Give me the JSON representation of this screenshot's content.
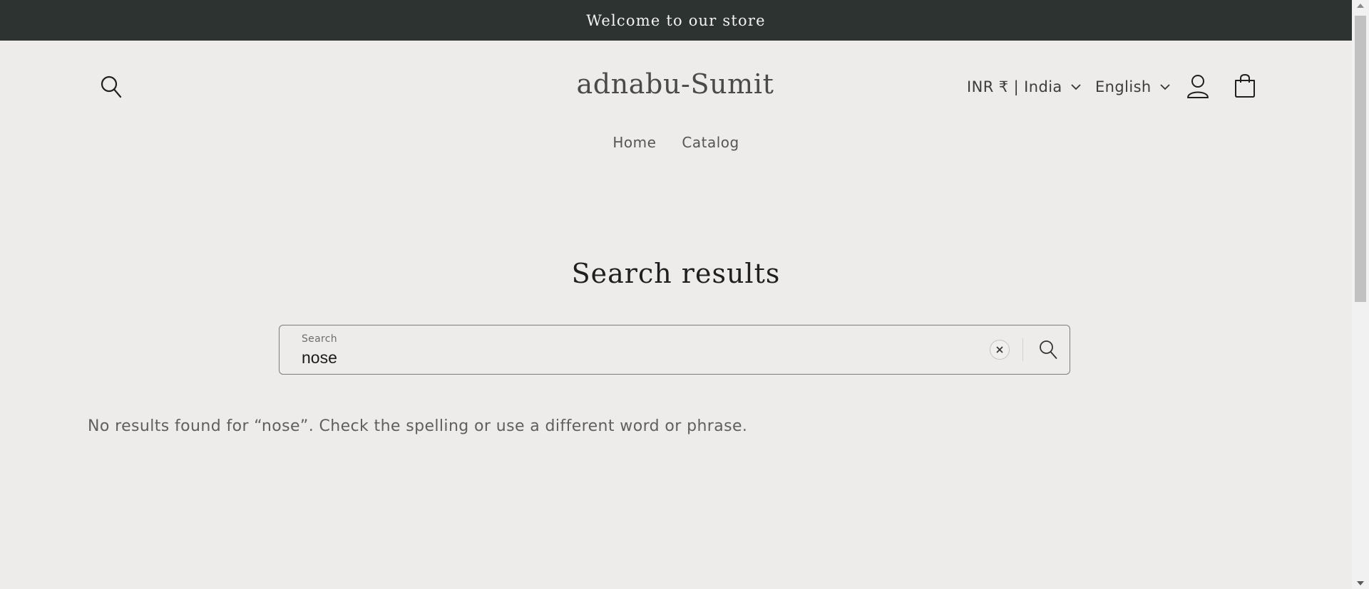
{
  "announcement": {
    "text": "Welcome to our store"
  },
  "header": {
    "logo": "adnabu-Sumit",
    "country_selector": "INR ₹ | India",
    "language_selector": "English",
    "icons": {
      "search": "search-icon",
      "account": "account-icon",
      "cart": "cart-icon",
      "chevron": "chevron-down-icon"
    }
  },
  "nav": {
    "items": [
      {
        "label": "Home"
      },
      {
        "label": "Catalog"
      }
    ]
  },
  "main": {
    "title": "Search results",
    "search": {
      "label": "Search",
      "value": "nose",
      "placeholder": "Search"
    },
    "no_results_message": "No results found for “nose”. Check the spelling or use a different word or phrase."
  },
  "colors": {
    "announcement_bg": "#2d3330",
    "page_bg": "#edecea",
    "text": "#2b2b2b"
  }
}
